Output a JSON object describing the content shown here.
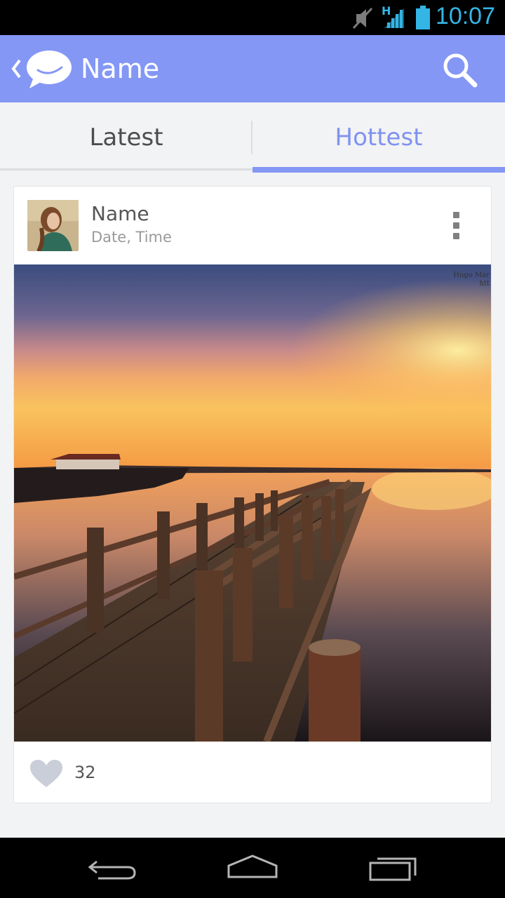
{
  "status_bar": {
    "time": "10:07",
    "network_label": "H",
    "icons": [
      "mute-icon",
      "signal-icon",
      "battery-icon"
    ],
    "accent_color": "#33b5e5"
  },
  "app_bar": {
    "title": "Name",
    "background_color": "#8497f5",
    "icons": [
      "back-chevron-icon",
      "chat-bubble-logo-icon",
      "search-icon"
    ]
  },
  "tabs": [
    {
      "label": "Latest",
      "selected": false
    },
    {
      "label": "Hottest",
      "selected": true
    }
  ],
  "post": {
    "author_name": "Name",
    "datetime": "Date, Time",
    "menu_icon": "more-vert-icon",
    "photo_credit": "Hugo Mar\nhtt",
    "like_icon": "heart-icon",
    "likes": "32"
  },
  "nav_bar": {
    "icons": [
      "back-icon",
      "home-icon",
      "recent-apps-icon"
    ]
  }
}
